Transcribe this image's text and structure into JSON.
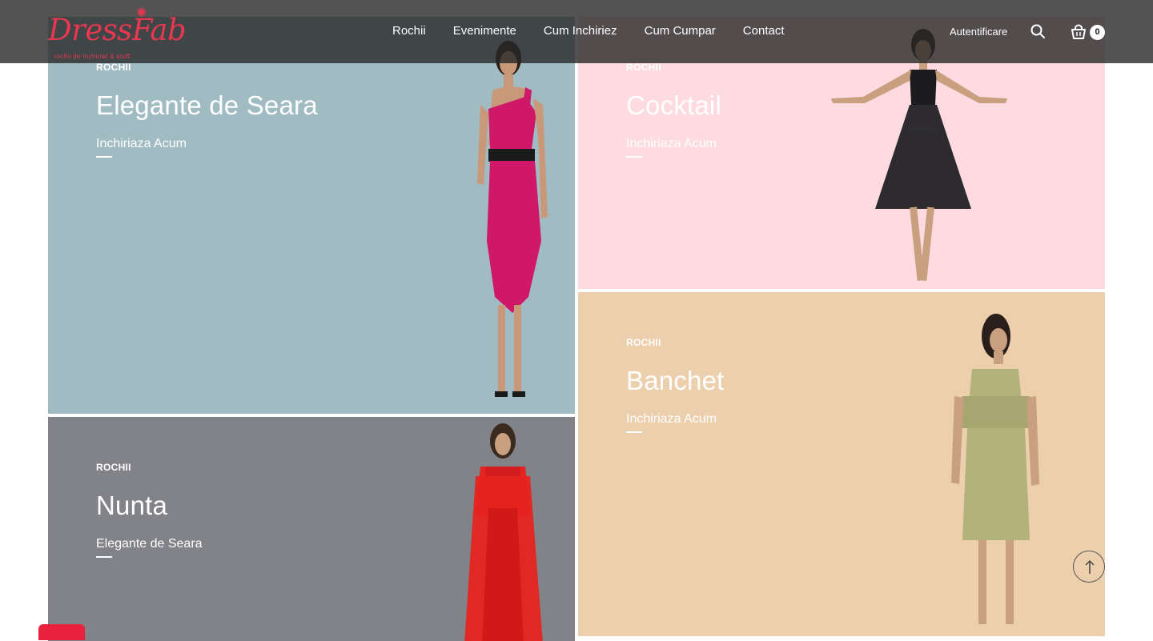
{
  "brand": {
    "logo_text": "DressFab",
    "logo_tagline": "rochii de inchiriat & stuff"
  },
  "nav": {
    "items": [
      {
        "label": "Rochii"
      },
      {
        "label": "Evenimente"
      },
      {
        "label": "Cum Inchiriez"
      },
      {
        "label": "Cum Cumpar"
      },
      {
        "label": "Contact"
      }
    ],
    "login_label": "Autentificare",
    "search_icon": "search-icon",
    "cart_icon": "shopping-bag-icon",
    "cart_count": "0"
  },
  "tiles": [
    {
      "eyebrow": "ROCHII",
      "title": "Elegante de Seara",
      "link": "Inchiriaza Acum",
      "bg": "#a1bbc2",
      "dress_color": "#d01869"
    },
    {
      "eyebrow": "ROCHII",
      "title": "Cocktail",
      "link": "Inchiriaza Acum",
      "bg": "#fddbe0",
      "dress_color": "#1c1c1f"
    },
    {
      "eyebrow": "ROCHII",
      "title": "Banchet",
      "link": "Inchiriaza Acum",
      "bg": "#eccfad",
      "dress_color": "#b3b27a"
    },
    {
      "eyebrow": "ROCHII",
      "title": "Nunta",
      "link": "Elegante de Seara",
      "bg": "#828388",
      "dress_color": "#e5231f"
    }
  ],
  "ui": {
    "scroll_top_icon": "arrow-up-icon",
    "accent": "#e8384f",
    "header_bg": "rgba(40,40,40,0.80)"
  }
}
